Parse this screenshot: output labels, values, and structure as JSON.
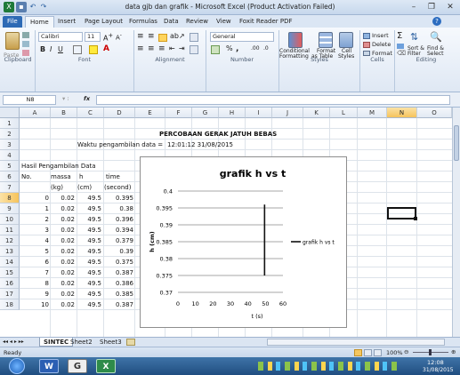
{
  "window": {
    "title": "data gjb dan grafik - Microsoft Excel (Product Activation Failed)"
  },
  "tabs": [
    "File",
    "Home",
    "Insert",
    "Page Layout",
    "Formulas",
    "Data",
    "Review",
    "View",
    "Foxit Reader PDF"
  ],
  "ribbon": {
    "paste": "Paste",
    "font_name": "Calibri",
    "font_size": "11",
    "number_format": "General",
    "conditional": "Conditional",
    "formatting": "Formatting",
    "format_as": "Format",
    "as_table": "as Table",
    "cell": "Cell",
    "styles_btn": "Styles",
    "insert": "Insert",
    "delete": "Delete",
    "format": "Format",
    "sort": "Sort &",
    "filter": "Filter",
    "find": "Find &",
    "select": "Select",
    "groups": {
      "clipboard": "Clipboard",
      "font": "Font",
      "alignment": "Alignment",
      "number": "Number",
      "styles": "Styles",
      "cells": "Cells",
      "editing": "Editing"
    }
  },
  "formula_bar": {
    "name_box": "N8",
    "fx": "fx",
    "value": ""
  },
  "columns": [
    "A",
    "B",
    "C",
    "D",
    "E",
    "F",
    "G",
    "H",
    "I",
    "J",
    "K",
    "L",
    "M",
    "N",
    "O"
  ],
  "rows": [
    "1",
    "2",
    "3",
    "4",
    "5",
    "6",
    "7",
    "8",
    "9",
    "10",
    "11",
    "12",
    "13",
    "14",
    "15",
    "16",
    "17",
    "18"
  ],
  "cells": {
    "title": "PERCOBAAN GERAK JATUH BEBAS",
    "waktu_label": "Waktu pengambilan data =",
    "waktu_value": "12:01:12 31/08/2015",
    "hasil": "Hasil Pengambilan Data",
    "h_no": "No.",
    "h_massa": "massa",
    "h_h": "h",
    "h_time": "time",
    "u_massa": "(kg)",
    "u_h": "(cm)",
    "u_time": "(second)"
  },
  "table": [
    [
      "0",
      "0.02",
      "49.5",
      "0.395"
    ],
    [
      "1",
      "0.02",
      "49.5",
      "0.38"
    ],
    [
      "2",
      "0.02",
      "49.5",
      "0.396"
    ],
    [
      "3",
      "0.02",
      "49.5",
      "0.394"
    ],
    [
      "4",
      "0.02",
      "49.5",
      "0.379"
    ],
    [
      "5",
      "0.02",
      "49.5",
      "0.39"
    ],
    [
      "6",
      "0.02",
      "49.5",
      "0.375"
    ],
    [
      "7",
      "0.02",
      "49.5",
      "0.387"
    ],
    [
      "8",
      "0.02",
      "49.5",
      "0.386"
    ],
    [
      "9",
      "0.02",
      "49.5",
      "0.385"
    ],
    [
      "10",
      "0.02",
      "49.5",
      "0.387"
    ]
  ],
  "chart_data": {
    "type": "line",
    "title": "grafik h vs t",
    "xlabel": "t (s)",
    "ylabel": "h (cm)",
    "xlim": [
      0,
      60
    ],
    "ylim": [
      0.37,
      0.4
    ],
    "xticks": [
      "0",
      "10",
      "20",
      "30",
      "40",
      "50",
      "60"
    ],
    "yticks": [
      "0.37",
      "0.375",
      "0.38",
      "0.385",
      "0.39",
      "0.395",
      "0.4"
    ],
    "grid": true,
    "legend": "right",
    "series": [
      {
        "name": "grafik h vs t",
        "x": [
          49.5,
          49.5
        ],
        "y": [
          0.375,
          0.396
        ]
      }
    ]
  },
  "sheets": [
    "SINTEC",
    "Sheet2",
    "Sheet3"
  ],
  "status": {
    "ready": "Ready",
    "zoom": "100%"
  },
  "clock": {
    "time": "12:08",
    "date": "31/08/2015"
  }
}
